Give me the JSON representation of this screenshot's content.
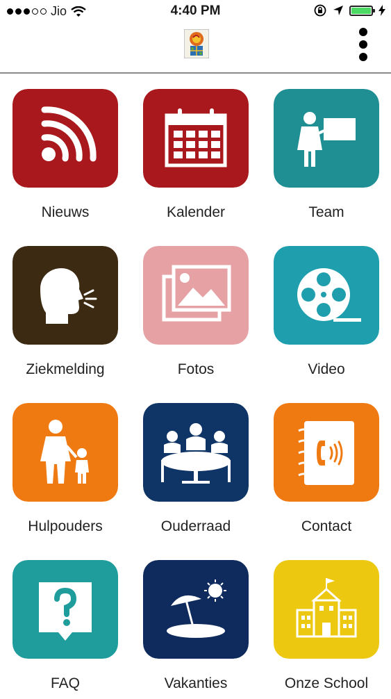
{
  "status_bar": {
    "carrier": "Jio",
    "time": "4:40 PM",
    "battery_level": 1.0
  },
  "app_bar": {
    "logo_icon": "school-logo-icon",
    "menu_icon": "more-vertical-icon"
  },
  "tiles": [
    {
      "label": "Nieuws",
      "icon": "rss-icon",
      "color": "#a8181c"
    },
    {
      "label": "Kalender",
      "icon": "calendar-icon",
      "color": "#a8181c"
    },
    {
      "label": "Team",
      "icon": "teacher-icon",
      "color": "#1f8f94"
    },
    {
      "label": "Ziekmelding",
      "icon": "sick-person-icon",
      "color": "#3d2a12"
    },
    {
      "label": "Fotos",
      "icon": "photos-icon",
      "color": "#e6a1a4"
    },
    {
      "label": "Video",
      "icon": "film-reel-icon",
      "color": "#1f9fae"
    },
    {
      "label": "Hulpouders",
      "icon": "parent-child-icon",
      "color": "#f07a12"
    },
    {
      "label": "Ouderraad",
      "icon": "meeting-icon",
      "color": "#0f3466"
    },
    {
      "label": "Contact",
      "icon": "phonebook-icon",
      "color": "#f07a12"
    },
    {
      "label": "FAQ",
      "icon": "question-icon",
      "color": "#1f9c9c"
    },
    {
      "label": "Vakanties",
      "icon": "beach-icon",
      "color": "#0f2a5c"
    },
    {
      "label": "Onze School",
      "icon": "school-building-icon",
      "color": "#ecc810"
    }
  ]
}
